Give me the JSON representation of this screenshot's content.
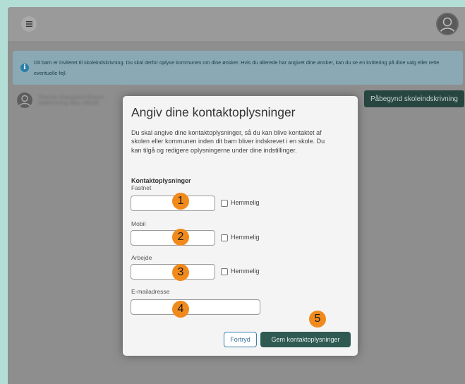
{
  "topbar": {
    "menu_icon": "hamburger-icon",
    "profile_icon": "user-avatar-icon"
  },
  "banner": {
    "icon": "info-icon",
    "icon_glyph": "i",
    "text": "Dit barn er inviteret til skoleindskrivning. Du skal derfor oplyse kommunen om dine ønsker. Hvis du allerede har angivet dine ønsker, kan du se en kvittering på dine valg eller rette eventuelle fejl."
  },
  "child": {
    "name": "Thomas Overgaard Olesen",
    "status": "Indskrivning ikke udfyldt",
    "start_button": "Påbegynd skoleindskrivning"
  },
  "modal": {
    "title": "Angiv dine kontaktoplysninger",
    "description": "Du skal angive dine kontaktoplysninger, så du kan blive kontaktet af skolen eller kommunen inden dit barn bliver indskrevet i en skole. Du kan tilgå og redigere oplysningerne under dine indstillinger.",
    "section_heading": "Kontaktoplysninger",
    "fields": [
      {
        "label": "Fastnet",
        "value": "",
        "secret_label": "Hemmelig",
        "secret_checked": false,
        "marker": "1"
      },
      {
        "label": "Mobil",
        "value": "",
        "secret_label": "Hemmelig",
        "secret_checked": false,
        "marker": "2"
      },
      {
        "label": "Arbejde",
        "value": "",
        "secret_label": "Hemmelig",
        "secret_checked": false,
        "marker": "3"
      },
      {
        "label": "E-mailadresse",
        "value": "",
        "marker": "4"
      }
    ],
    "cancel_label": "Fortryd",
    "save_label": "Gem kontaktoplysninger",
    "save_marker": "5"
  },
  "colors": {
    "accent": "#2f5a52",
    "marker": "#f08a1c",
    "info": "#2a7fa8"
  }
}
